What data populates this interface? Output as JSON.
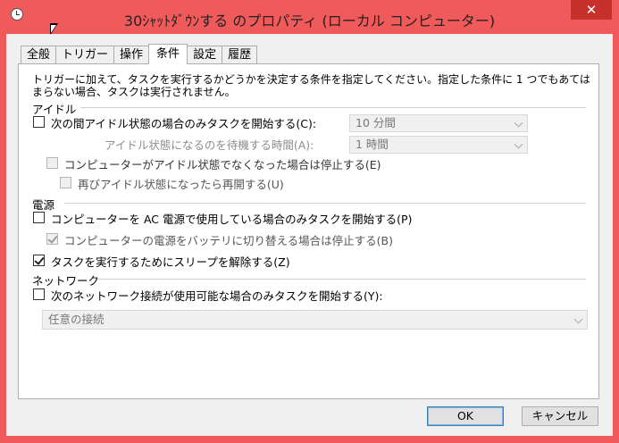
{
  "window": {
    "title": "30ｼｬｯﾄﾀﾞｳﾝする のプロパティ (ローカル コンピューター)",
    "close": "✕"
  },
  "tabs": [
    {
      "label": "全般",
      "active": false
    },
    {
      "label": "トリガー",
      "active": false
    },
    {
      "label": "操作",
      "active": false
    },
    {
      "label": "条件",
      "active": true
    },
    {
      "label": "設定",
      "active": false
    },
    {
      "label": "履歴",
      "active": false
    }
  ],
  "description": "トリガーに加えて、タスクを実行するかどうかを決定する条件を指定してください。指定した条件に 1 つでもあてはまらない場合、タスクは実行されません。",
  "idle": {
    "section": "アイドル",
    "start_only_if_idle": {
      "label": "次の間アイドル状態の場合のみタスクを開始する(C):",
      "checked": false,
      "value": "10 分間"
    },
    "wait_for_idle": {
      "label": "アイドル状態になるのを待機する時間(A):",
      "value": "1 時間"
    },
    "stop_if_not_idle": {
      "label": "コンピューターがアイドル状態でなくなった場合は停止する(E)",
      "checked": false
    },
    "restart_if_idle": {
      "label": "再びアイドル状態になったら再開する(U)",
      "checked": false
    }
  },
  "power": {
    "section": "電源",
    "ac_only": {
      "label": "コンピューターを AC 電源で使用している場合のみタスクを開始する(P)",
      "checked": false
    },
    "stop_on_battery": {
      "label": "コンピューターの電源をバッテリに切り替える場合は停止する(B)",
      "checked": true
    },
    "wake_to_run": {
      "label": "タスクを実行するためにスリープを解除する(Z)",
      "checked": true
    }
  },
  "network": {
    "section": "ネットワーク",
    "network_only": {
      "label": "次のネットワーク接続が使用可能な場合のみタスクを開始する(Y):",
      "checked": false
    },
    "connection": "任意の接続"
  },
  "buttons": {
    "ok": "OK",
    "cancel": "キャンセル"
  }
}
